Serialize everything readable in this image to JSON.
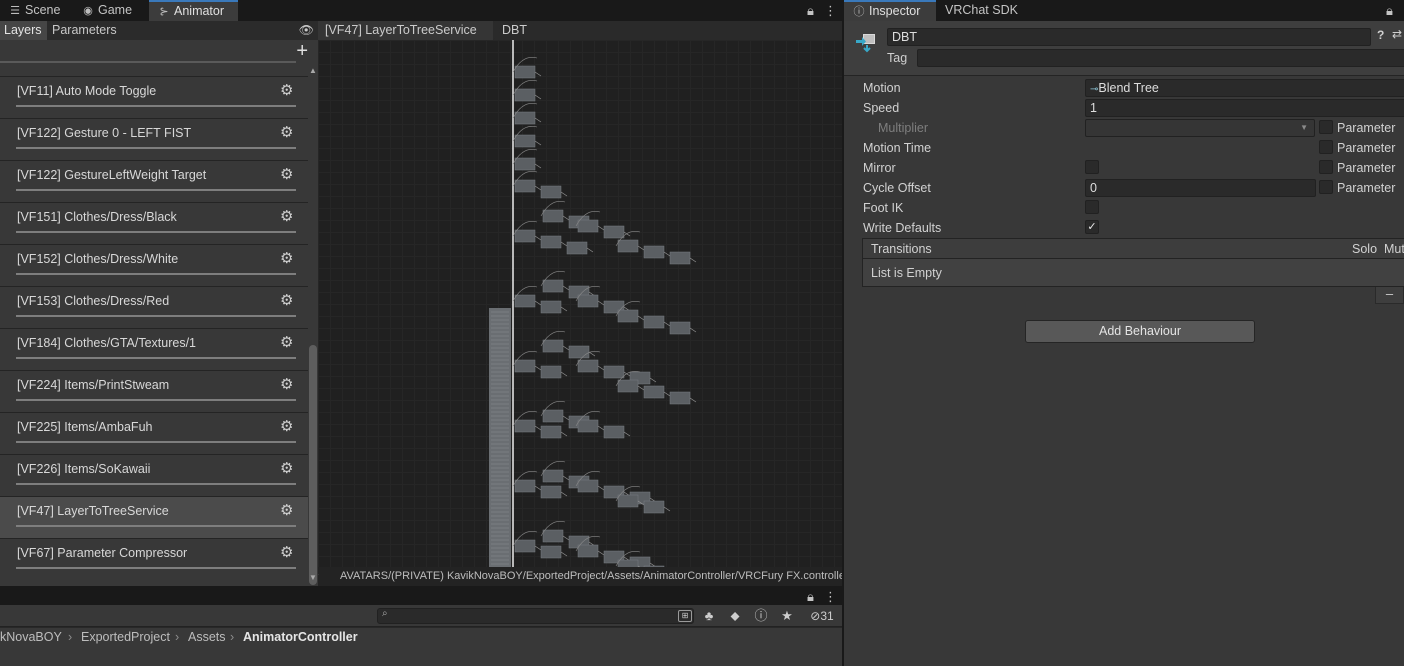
{
  "animator_window": {
    "tabs": [
      {
        "label": "Scene",
        "icon": "scene-icon"
      },
      {
        "label": "Game",
        "icon": "gamepad-icon"
      },
      {
        "label": "Animator",
        "icon": "animator-icon"
      }
    ],
    "active_tab": "Animator",
    "subtabs": [
      "Layers",
      "Parameters"
    ],
    "active_subtab": "Layers",
    "layers": [
      "[VF11] Auto Mode Toggle",
      "[VF122] Gesture 0 - LEFT FIST",
      "[VF122] GestureLeftWeight Target",
      "[VF151] Clothes/Dress/Black",
      "[VF152] Clothes/Dress/White",
      "[VF153] Clothes/Dress/Red",
      "[VF184] Clothes/GTA/Textures/1",
      "[VF224] Items/PrintStweam",
      "[VF225] Items/AmbaFuh",
      "[VF226] Items/SoKawaii",
      "[VF47] LayerToTreeService",
      "[VF67] Parameter Compressor"
    ],
    "selected_layer": "[VF47] LayerToTreeService",
    "breadcrumb": [
      "[VF47] LayerToTreeService",
      "DBT"
    ],
    "controller_path": "AVATARS/(PRIVATE) KavikNovaBOY/ExportedProject/Assets/AnimatorController/VRCFury FX.controller"
  },
  "project_bar": {
    "search_value": "",
    "hidden_count": "31",
    "path": [
      "kNovaBOY",
      "ExportedProject",
      "Assets",
      "AnimatorController"
    ]
  },
  "inspector_window": {
    "tabs": [
      {
        "label": "Inspector",
        "icon": "info-icon"
      },
      {
        "label": "VRChat SDK",
        "icon": ""
      }
    ],
    "state_name": "DBT",
    "tag_label": "Tag",
    "tag_value": "",
    "properties": {
      "motion_label": "Motion",
      "motion_value": "Blend Tree",
      "speed_label": "Speed",
      "speed_value": "1",
      "multiplier_label": "Multiplier",
      "motion_time_label": "Motion Time",
      "mirror_label": "Mirror",
      "cycle_offset_label": "Cycle Offset",
      "cycle_offset_value": "0",
      "foot_ik_label": "Foot IK",
      "write_defaults_label": "Write Defaults",
      "parameter_label": "Parameter"
    },
    "checkbox_states": {
      "multiplier_param": false,
      "motion_time_param": false,
      "mirror": false,
      "mirror_param": false,
      "cycle_offset_param": false,
      "foot_ik": false,
      "write_defaults": true
    },
    "transitions": {
      "title": "Transitions",
      "solo": "Solo",
      "mute": "Mut",
      "empty_text": "List is Empty",
      "remove_label": "–"
    },
    "add_behaviour_label": "Add Behaviour"
  }
}
